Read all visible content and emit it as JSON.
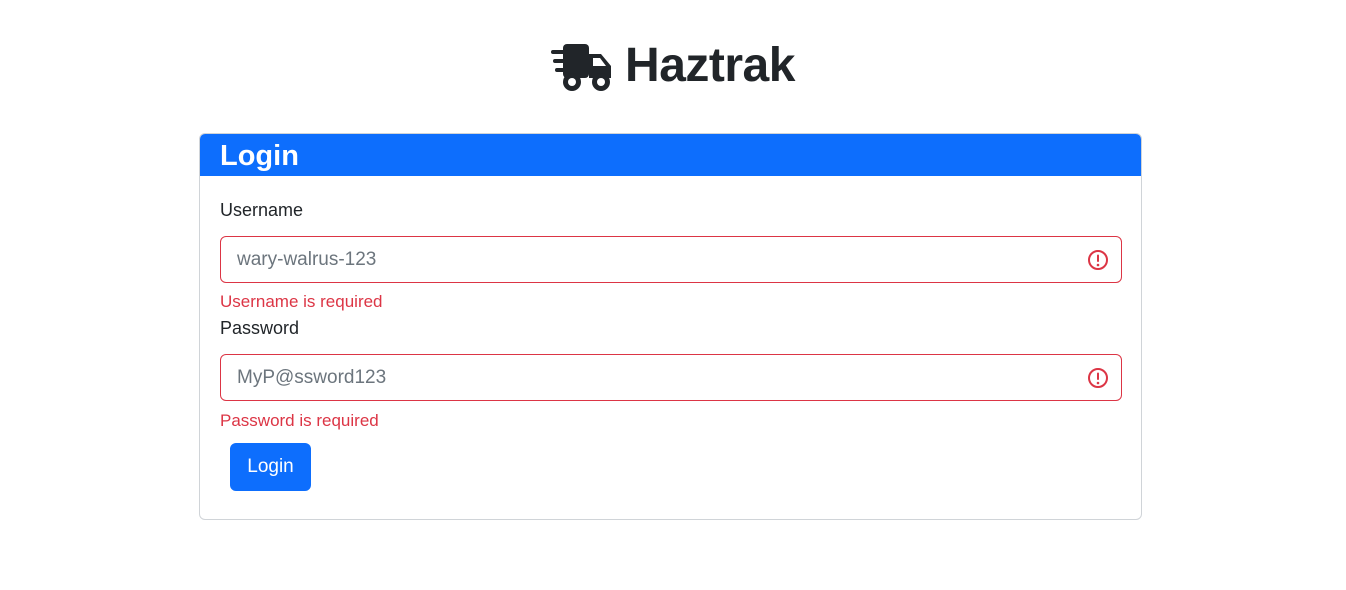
{
  "brand": {
    "icon": "truck-fast-icon",
    "title": "Haztrak"
  },
  "login_card": {
    "header_title": "Login",
    "username": {
      "label": "Username",
      "placeholder": "wary-walrus-123",
      "value": "",
      "error": "Username is required",
      "error_icon": "exclamation-circle-icon"
    },
    "password": {
      "label": "Password",
      "placeholder": "MyP@ssword123",
      "value": "",
      "error": "Password is required",
      "error_icon": "exclamation-circle-icon"
    },
    "submit_label": "Login"
  },
  "colors": {
    "primary": "#0d6efd",
    "danger": "#dc3545",
    "text": "#212529",
    "placeholder": "#6c757d"
  }
}
